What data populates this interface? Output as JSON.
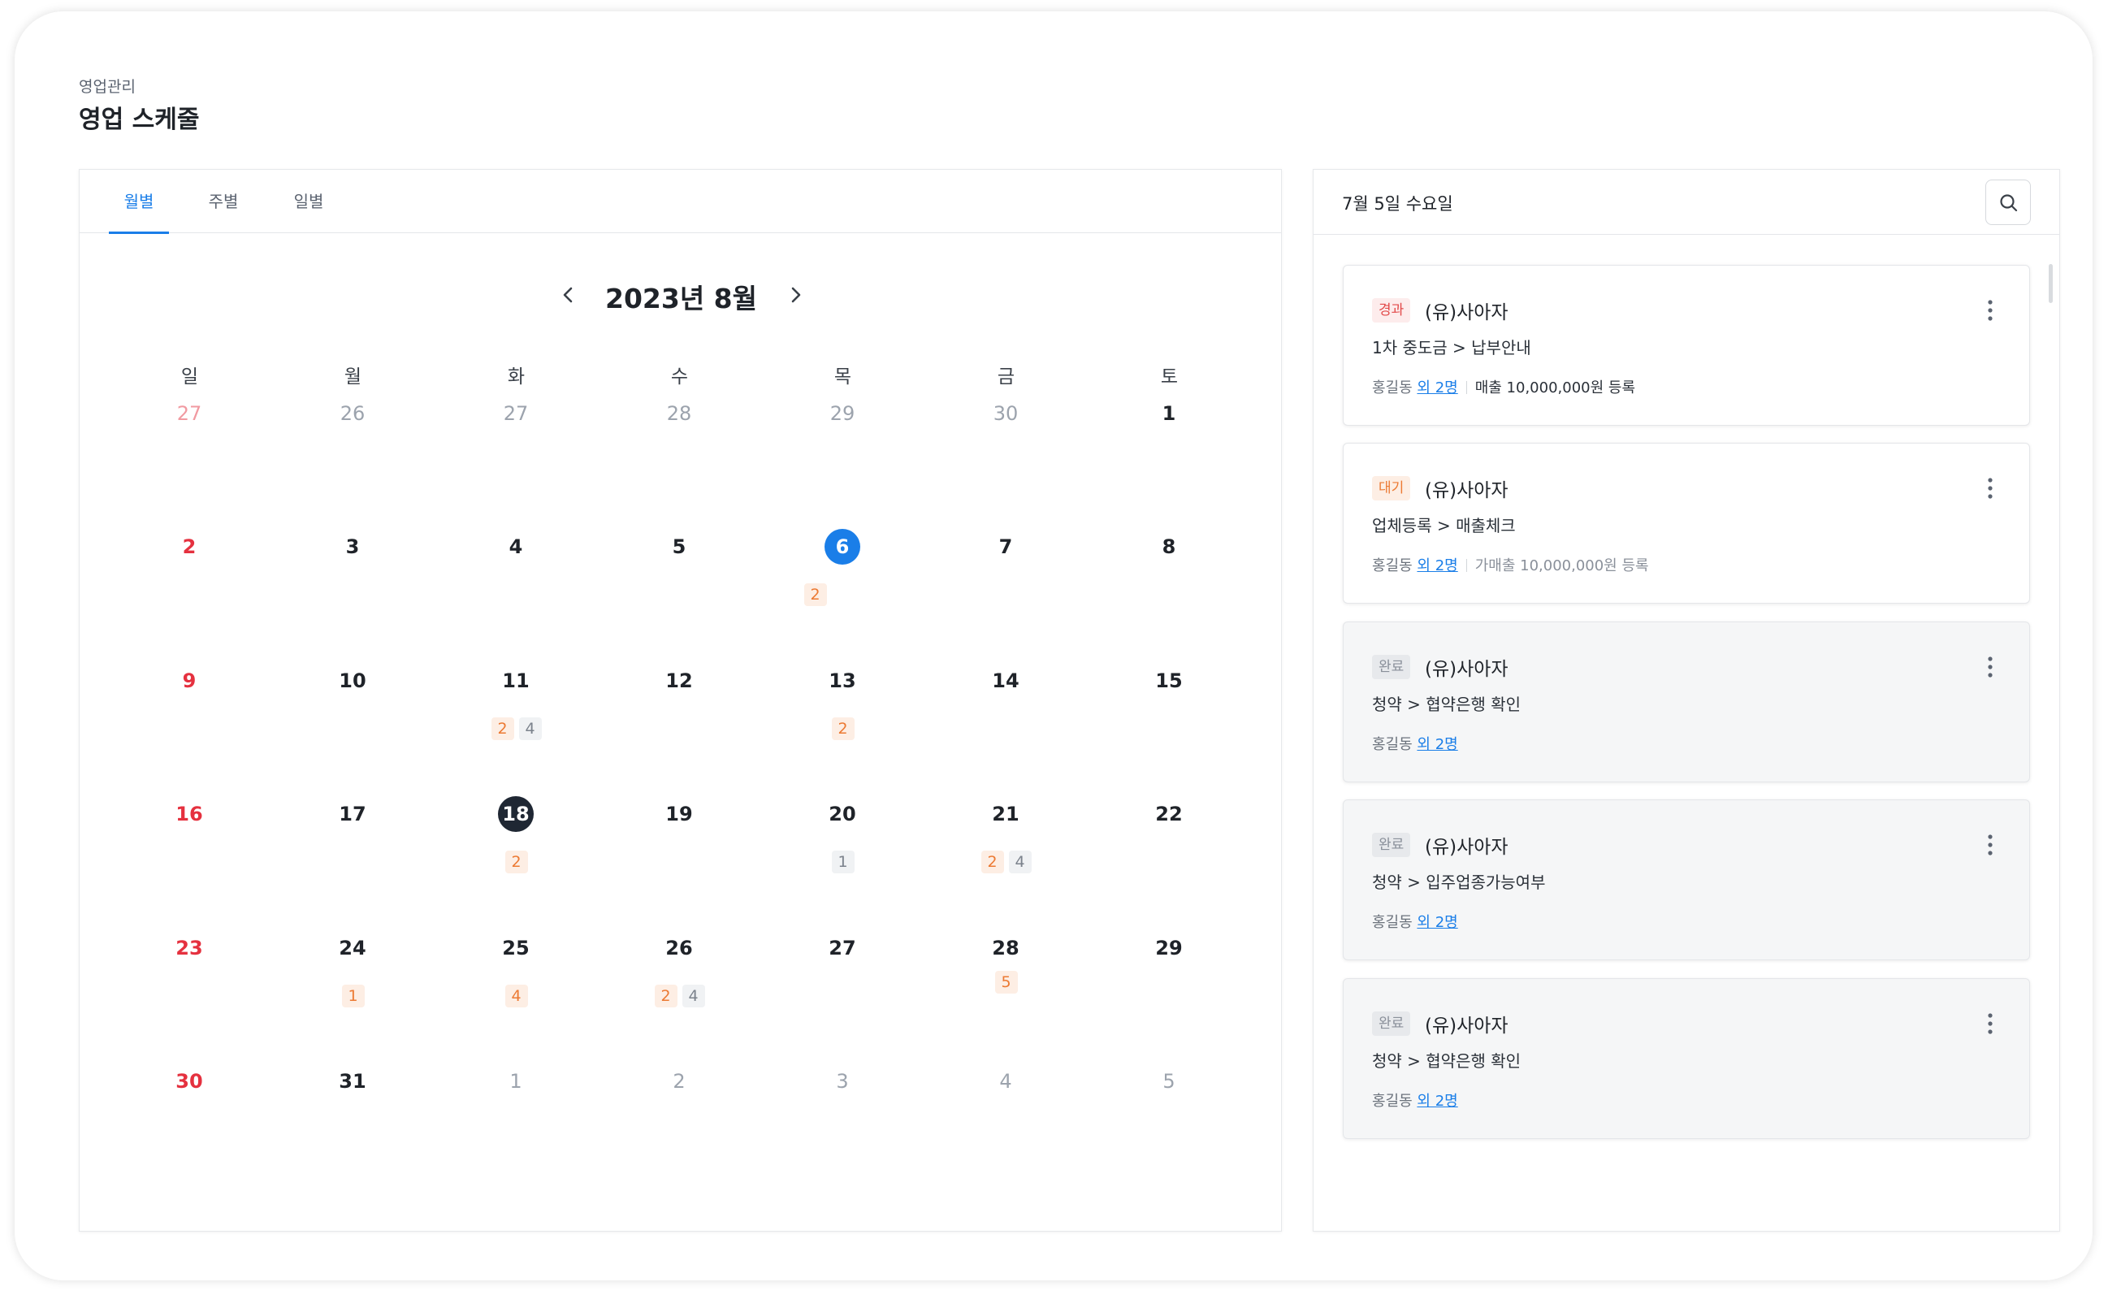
{
  "header": {
    "breadcrumb": "영업관리",
    "title": "영업 스케줄"
  },
  "tabs": [
    {
      "label": "월별"
    },
    {
      "label": "주별"
    },
    {
      "label": "일별"
    }
  ],
  "calendar": {
    "month_label": "2023년 8월",
    "weekdays": [
      "일",
      "월",
      "화",
      "수",
      "목",
      "금",
      "토"
    ],
    "weeks": [
      [
        {
          "d": "27",
          "other": true
        },
        {
          "d": "26",
          "other": true
        },
        {
          "d": "27",
          "other": true
        },
        {
          "d": "28",
          "other": true
        },
        {
          "d": "29",
          "other": true
        },
        {
          "d": "30",
          "other": true
        },
        {
          "d": "1"
        }
      ],
      [
        {
          "d": "2"
        },
        {
          "d": "3"
        },
        {
          "d": "4"
        },
        {
          "d": "5"
        },
        {
          "d": "6",
          "today": true,
          "badges": [
            {
              "v": "2",
              "c": "orange"
            }
          ]
        },
        {
          "d": "7"
        },
        {
          "d": "8"
        }
      ],
      [
        {
          "d": "9"
        },
        {
          "d": "10"
        },
        {
          "d": "11",
          "badges": [
            {
              "v": "2",
              "c": "orange"
            },
            {
              "v": "4",
              "c": "gray"
            }
          ]
        },
        {
          "d": "12"
        },
        {
          "d": "13",
          "badges": [
            {
              "v": "2",
              "c": "orange"
            }
          ]
        },
        {
          "d": "14"
        },
        {
          "d": "15"
        }
      ],
      [
        {
          "d": "16"
        },
        {
          "d": "17"
        },
        {
          "d": "18",
          "selected": true,
          "badges": [
            {
              "v": "2",
              "c": "orange"
            }
          ]
        },
        {
          "d": "19"
        },
        {
          "d": "20",
          "badges": [
            {
              "v": "1",
              "c": "gray"
            }
          ]
        },
        {
          "d": "21",
          "badges": [
            {
              "v": "2",
              "c": "orange"
            },
            {
              "v": "4",
              "c": "gray"
            }
          ]
        },
        {
          "d": "22"
        }
      ],
      [
        {
          "d": "23"
        },
        {
          "d": "24",
          "badges": [
            {
              "v": "1",
              "c": "orange"
            }
          ]
        },
        {
          "d": "25",
          "badges": [
            {
              "v": "4",
              "c": "orange"
            }
          ]
        },
        {
          "d": "26",
          "badges": [
            {
              "v": "2",
              "c": "orange"
            },
            {
              "v": "4",
              "c": "gray"
            }
          ]
        },
        {
          "d": "27"
        },
        {
          "d": "28",
          "badges": [
            {
              "v": "5",
              "c": "orange"
            }
          ]
        },
        {
          "d": "29"
        }
      ],
      [
        {
          "d": "30"
        },
        {
          "d": "31"
        },
        {
          "d": "1",
          "other": true
        },
        {
          "d": "2",
          "other": true
        },
        {
          "d": "3",
          "other": true
        },
        {
          "d": "4",
          "other": true
        },
        {
          "d": "5",
          "other": true
        }
      ]
    ]
  },
  "schedule": {
    "date_label": "7월 5일 수요일",
    "items": [
      {
        "status": "경과",
        "status_color": "red",
        "company": "(유)사아자",
        "task": "1차 중도금 > 납부안내",
        "person": "홍길동",
        "others": "외 2명",
        "note": "매출 10,000,000원 등록",
        "note_style": "dark",
        "done": false
      },
      {
        "status": "대기",
        "status_color": "orange",
        "company": "(유)사아자",
        "task": "업체등록 > 매출체크",
        "person": "홍길동",
        "others": "외 2명",
        "note": "가매출 10,000,000원 등록",
        "note_style": "light",
        "done": false
      },
      {
        "status": "완료",
        "status_color": "gray",
        "company": "(유)사아자",
        "task": "청약 > 협약은행 확인",
        "person": "홍길동",
        "others": "외 2명",
        "note": "",
        "done": true
      },
      {
        "status": "완료",
        "status_color": "gray",
        "company": "(유)사아자",
        "task": "청약 > 입주업종가능여부",
        "person": "홍길동",
        "others": "외 2명",
        "note": "",
        "done": true
      },
      {
        "status": "완료",
        "status_color": "gray",
        "company": "(유)사아자",
        "task": "청약 > 협약은행 확인",
        "person": "홍길동",
        "others": "외 2명",
        "note": "",
        "done": true
      }
    ]
  },
  "icons": {
    "prev": "chevron-left-icon",
    "next": "chevron-right-icon",
    "search": "search-icon",
    "more": "more-vertical-icon"
  },
  "colors": {
    "accent": "#1a7ee8",
    "sunday": "#e5313f",
    "selected": "#1f2733",
    "badge_orange": "#ec7a33"
  }
}
